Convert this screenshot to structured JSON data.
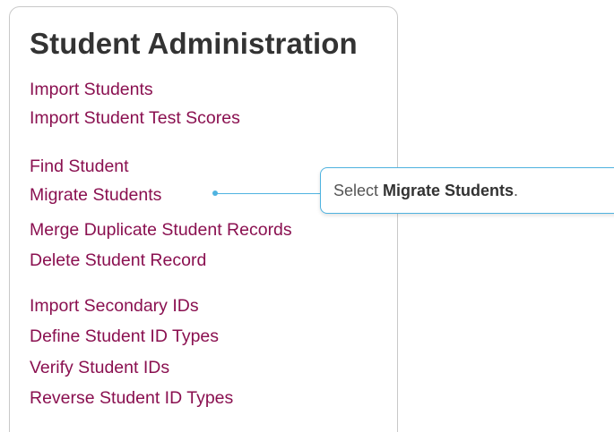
{
  "panel": {
    "title": "Student Administration",
    "links": {
      "import_students": "Import Students",
      "import_test_scores": "Import Student Test Scores",
      "find_student": "Find Student",
      "migrate_students": "Migrate Students",
      "merge_duplicates": "Merge Duplicate Student Records",
      "delete_student": "Delete Student Record",
      "import_secondary_ids": "Import Secondary IDs",
      "define_id_types": "Define Student ID Types",
      "verify_ids": "Verify Student IDs",
      "reverse_id_types": "Reverse Student ID Types"
    }
  },
  "callout": {
    "prefix": "Select ",
    "emphasis": "Migrate Students",
    "suffix": "."
  },
  "colors": {
    "link": "#8a1050",
    "title": "#333333",
    "callout_accent": "#4fb3e0",
    "panel_border": "#c9c9c9"
  }
}
